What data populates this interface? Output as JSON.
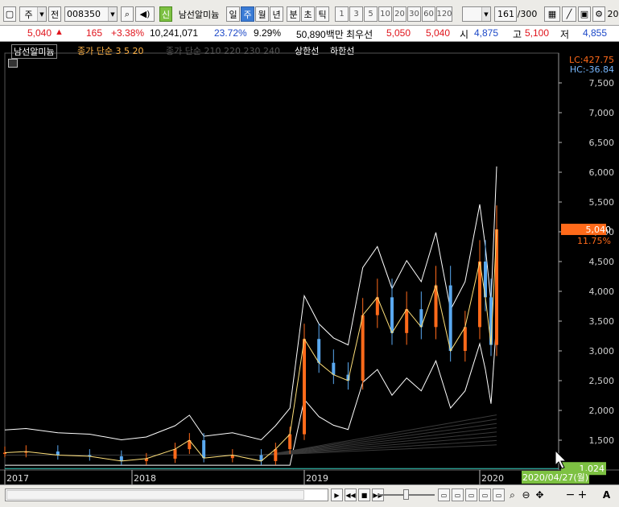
{
  "toolbar": {
    "market": "주",
    "prefix": "전",
    "code": "008350",
    "new_badge": "신",
    "stock_name": "남선알미늄",
    "periods": [
      "일",
      "주",
      "월",
      "년",
      "분",
      "초",
      "틱"
    ],
    "selected_period": "주",
    "intervals": [
      "1",
      "3",
      "5",
      "10",
      "20",
      "30",
      "60",
      "120"
    ],
    "page_count": "161",
    "page_total": "/300",
    "right_edge": "20"
  },
  "quote": {
    "price": "5,040",
    "arrow": "▲",
    "change": "165",
    "change_pct": "+3.38%",
    "volume": "10,241,071",
    "vol_pct1": "23.72%",
    "vol_pct2": "9.29%",
    "amount": "50,890백만",
    "best_label": "최우선",
    "best_ask": "5,050",
    "best_bid": "5,040",
    "open_label": "시",
    "open": "4,875",
    "high_label": "고",
    "high": "5,100",
    "low_label": "저",
    "low": "4,855"
  },
  "legend": {
    "name": "남선알미늄",
    "ma_label": "종가 단순 3  5  20",
    "ma_long": "종가 단순 210  220  230  240",
    "limit_up": "상한선",
    "limit_down": "하한선"
  },
  "right_axis": {
    "lc": "LC:427.75",
    "hc": "HC:-36.84",
    "current_price": "5,040",
    "current_pct": "11.75%",
    "low_marker": "1,024",
    "current_date": "2020/04/27(월)"
  },
  "colors": {
    "up": "#ff6a1a",
    "down": "#5aa9f0",
    "ma3": "#ffe07a",
    "ma_white": "#ffffff",
    "limit_line": "#39d3c4",
    "accent_green": "#7dc142"
  },
  "chart_data": {
    "type": "candlestick",
    "title": "",
    "xlabel": "",
    "ylabel": "",
    "ylim": [
      1000,
      8000
    ],
    "y_ticks": [
      1500,
      2000,
      2500,
      3000,
      3500,
      4000,
      4500,
      5000,
      5500,
      6000,
      6500,
      7000,
      7500
    ],
    "y_tick_labels": [
      "1,500",
      "2,000",
      "2,500",
      "3,000",
      "3,500",
      "4,000",
      "4,500",
      "5,000",
      "5,500",
      "6,000",
      "6,500",
      "7,000",
      "7,500"
    ],
    "x_ticks": [
      "2017",
      "2018",
      "2019",
      "2020"
    ],
    "series": [
      {
        "name": "종가",
        "x": [
          "2017-01",
          "2017-03",
          "2017-06",
          "2017-09",
          "2017-12",
          "2018-02",
          "2018-04",
          "2018-05",
          "2018-06",
          "2018-08",
          "2018-10",
          "2018-11",
          "2018-12",
          "2019-01",
          "2019-02",
          "2019-03",
          "2019-04",
          "2019-05",
          "2019-06",
          "2019-07",
          "2019-08",
          "2019-09",
          "2019-10",
          "2019-11",
          "2019-12",
          "2020-01",
          "2020-02",
          "2020-03",
          "2020-04"
        ],
        "values": [
          1290,
          1310,
          1250,
          1230,
          1150,
          1190,
          1350,
          1500,
          1200,
          1250,
          1150,
          1350,
          1600,
          3200,
          2800,
          2600,
          2500,
          3600,
          3900,
          3300,
          3700,
          3400,
          4100,
          3000,
          3400,
          4500,
          3900,
          3100,
          5040
        ]
      }
    ]
  }
}
